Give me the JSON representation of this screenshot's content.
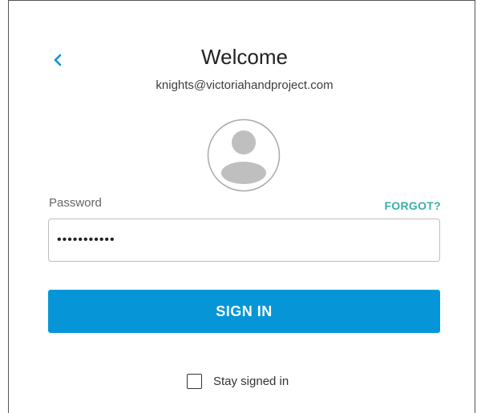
{
  "header": {
    "back_icon": "chevron-left-icon",
    "title": "Welcome",
    "email": "knights@victoriahandproject.com"
  },
  "avatar": {
    "icon": "user-avatar-icon"
  },
  "password": {
    "label": "Password",
    "forgot_label": "FORGOT?",
    "value": "•••••••••••"
  },
  "signin": {
    "label": "SIGN IN"
  },
  "stay_signed_in": {
    "label": "Stay signed in",
    "checked": false
  },
  "colors": {
    "accent": "#0696d7",
    "forgot_link": "#3aaea6",
    "back_chevron": "#0696d7"
  }
}
